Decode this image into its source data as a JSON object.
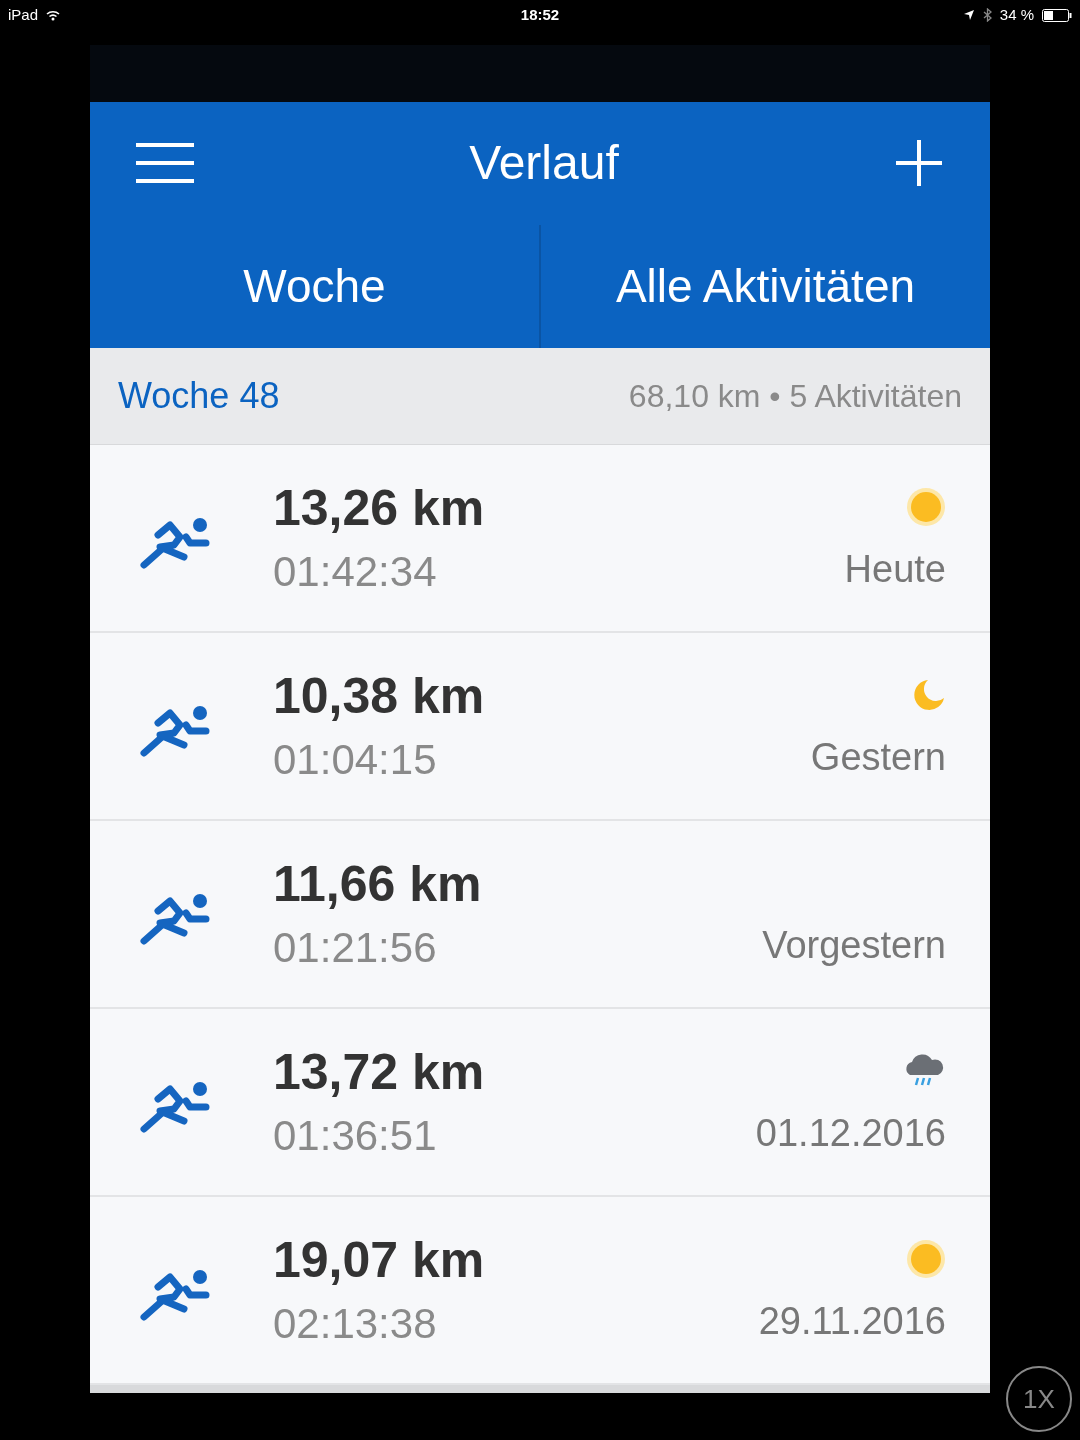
{
  "status_bar": {
    "device": "iPad",
    "time": "18:52",
    "battery": "34 %"
  },
  "header": {
    "title": "Verlauf"
  },
  "tabs": [
    {
      "label": "Woche"
    },
    {
      "label": "Alle Aktivitäten"
    }
  ],
  "week": {
    "label": "Woche 48",
    "summary": "68,10 km • 5 Aktivitäten"
  },
  "activities": [
    {
      "distance": "13,26 km",
      "duration": "01:42:34",
      "date": "Heute",
      "weather_icon": {
        "kind": "sun"
      }
    },
    {
      "distance": "10,38 km",
      "duration": "01:04:15",
      "date": "Gestern",
      "weather_icon": {
        "kind": "moon"
      }
    },
    {
      "distance": "11,66 km",
      "duration": "01:21:56",
      "date": "Vorgestern"
    },
    {
      "distance": "13,72 km",
      "duration": "01:36:51",
      "date": "01.12.2016",
      "weather_icon": {
        "kind": "rain"
      }
    },
    {
      "distance": "19,07 km",
      "duration": "02:13:38",
      "date": "29.11.2016",
      "weather_icon": {
        "kind": "sun"
      }
    }
  ],
  "zoom_button": "1X"
}
